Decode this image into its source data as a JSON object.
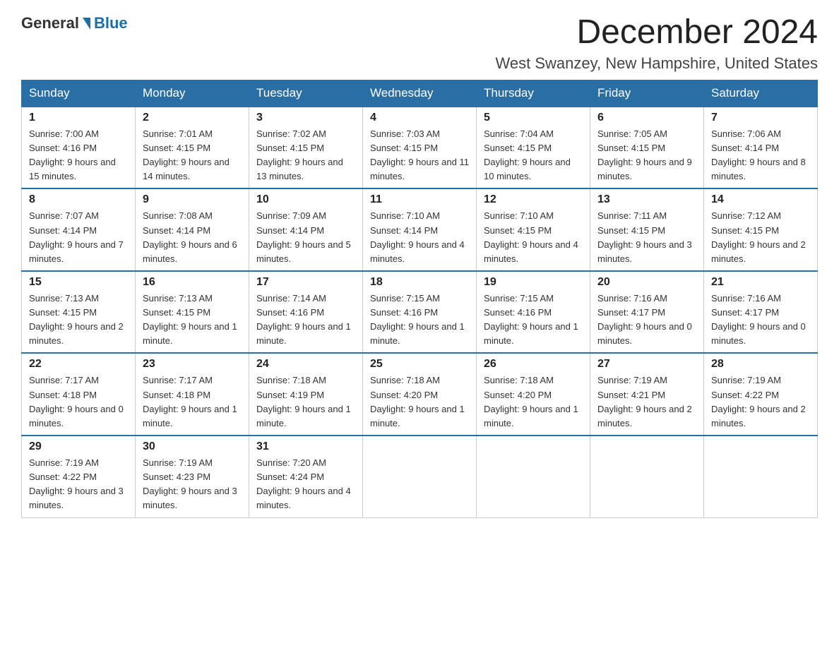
{
  "header": {
    "logo_general": "General",
    "logo_blue": "Blue",
    "title": "December 2024",
    "location": "West Swanzey, New Hampshire, United States"
  },
  "days_of_week": [
    "Sunday",
    "Monday",
    "Tuesday",
    "Wednesday",
    "Thursday",
    "Friday",
    "Saturday"
  ],
  "weeks": [
    [
      {
        "day": "1",
        "sunrise": "7:00 AM",
        "sunset": "4:16 PM",
        "daylight": "9 hours and 15 minutes."
      },
      {
        "day": "2",
        "sunrise": "7:01 AM",
        "sunset": "4:15 PM",
        "daylight": "9 hours and 14 minutes."
      },
      {
        "day": "3",
        "sunrise": "7:02 AM",
        "sunset": "4:15 PM",
        "daylight": "9 hours and 13 minutes."
      },
      {
        "day": "4",
        "sunrise": "7:03 AM",
        "sunset": "4:15 PM",
        "daylight": "9 hours and 11 minutes."
      },
      {
        "day": "5",
        "sunrise": "7:04 AM",
        "sunset": "4:15 PM",
        "daylight": "9 hours and 10 minutes."
      },
      {
        "day": "6",
        "sunrise": "7:05 AM",
        "sunset": "4:15 PM",
        "daylight": "9 hours and 9 minutes."
      },
      {
        "day": "7",
        "sunrise": "7:06 AM",
        "sunset": "4:14 PM",
        "daylight": "9 hours and 8 minutes."
      }
    ],
    [
      {
        "day": "8",
        "sunrise": "7:07 AM",
        "sunset": "4:14 PM",
        "daylight": "9 hours and 7 minutes."
      },
      {
        "day": "9",
        "sunrise": "7:08 AM",
        "sunset": "4:14 PM",
        "daylight": "9 hours and 6 minutes."
      },
      {
        "day": "10",
        "sunrise": "7:09 AM",
        "sunset": "4:14 PM",
        "daylight": "9 hours and 5 minutes."
      },
      {
        "day": "11",
        "sunrise": "7:10 AM",
        "sunset": "4:14 PM",
        "daylight": "9 hours and 4 minutes."
      },
      {
        "day": "12",
        "sunrise": "7:10 AM",
        "sunset": "4:15 PM",
        "daylight": "9 hours and 4 minutes."
      },
      {
        "day": "13",
        "sunrise": "7:11 AM",
        "sunset": "4:15 PM",
        "daylight": "9 hours and 3 minutes."
      },
      {
        "day": "14",
        "sunrise": "7:12 AM",
        "sunset": "4:15 PM",
        "daylight": "9 hours and 2 minutes."
      }
    ],
    [
      {
        "day": "15",
        "sunrise": "7:13 AM",
        "sunset": "4:15 PM",
        "daylight": "9 hours and 2 minutes."
      },
      {
        "day": "16",
        "sunrise": "7:13 AM",
        "sunset": "4:15 PM",
        "daylight": "9 hours and 1 minute."
      },
      {
        "day": "17",
        "sunrise": "7:14 AM",
        "sunset": "4:16 PM",
        "daylight": "9 hours and 1 minute."
      },
      {
        "day": "18",
        "sunrise": "7:15 AM",
        "sunset": "4:16 PM",
        "daylight": "9 hours and 1 minute."
      },
      {
        "day": "19",
        "sunrise": "7:15 AM",
        "sunset": "4:16 PM",
        "daylight": "9 hours and 1 minute."
      },
      {
        "day": "20",
        "sunrise": "7:16 AM",
        "sunset": "4:17 PM",
        "daylight": "9 hours and 0 minutes."
      },
      {
        "day": "21",
        "sunrise": "7:16 AM",
        "sunset": "4:17 PM",
        "daylight": "9 hours and 0 minutes."
      }
    ],
    [
      {
        "day": "22",
        "sunrise": "7:17 AM",
        "sunset": "4:18 PM",
        "daylight": "9 hours and 0 minutes."
      },
      {
        "day": "23",
        "sunrise": "7:17 AM",
        "sunset": "4:18 PM",
        "daylight": "9 hours and 1 minute."
      },
      {
        "day": "24",
        "sunrise": "7:18 AM",
        "sunset": "4:19 PM",
        "daylight": "9 hours and 1 minute."
      },
      {
        "day": "25",
        "sunrise": "7:18 AM",
        "sunset": "4:20 PM",
        "daylight": "9 hours and 1 minute."
      },
      {
        "day": "26",
        "sunrise": "7:18 AM",
        "sunset": "4:20 PM",
        "daylight": "9 hours and 1 minute."
      },
      {
        "day": "27",
        "sunrise": "7:19 AM",
        "sunset": "4:21 PM",
        "daylight": "9 hours and 2 minutes."
      },
      {
        "day": "28",
        "sunrise": "7:19 AM",
        "sunset": "4:22 PM",
        "daylight": "9 hours and 2 minutes."
      }
    ],
    [
      {
        "day": "29",
        "sunrise": "7:19 AM",
        "sunset": "4:22 PM",
        "daylight": "9 hours and 3 minutes."
      },
      {
        "day": "30",
        "sunrise": "7:19 AM",
        "sunset": "4:23 PM",
        "daylight": "9 hours and 3 minutes."
      },
      {
        "day": "31",
        "sunrise": "7:20 AM",
        "sunset": "4:24 PM",
        "daylight": "9 hours and 4 minutes."
      },
      null,
      null,
      null,
      null
    ]
  ]
}
